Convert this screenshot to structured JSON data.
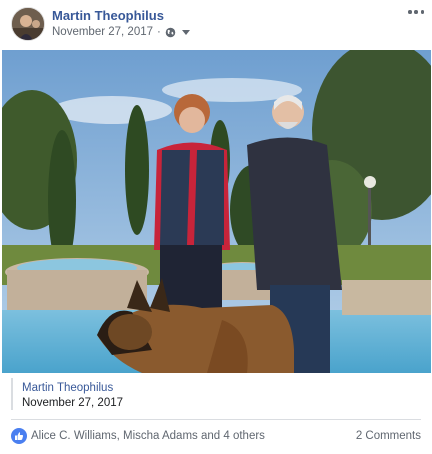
{
  "post": {
    "author": "Martin Theophilus",
    "date": "November 27, 2017",
    "separator": "·",
    "privacy_icon": "globe-icon",
    "menu_icon": "more-options-icon"
  },
  "shared": {
    "author": "Martin Theophilus",
    "date": "November 27, 2017"
  },
  "reactions": {
    "icon": "like-icon",
    "names": "Alice C. Williams, Mischa Adams and 4 others",
    "comments": "2 Comments"
  },
  "colors": {
    "link": "#385898",
    "secondary_text": "#606770",
    "like_badge": "#4a7ff0"
  }
}
